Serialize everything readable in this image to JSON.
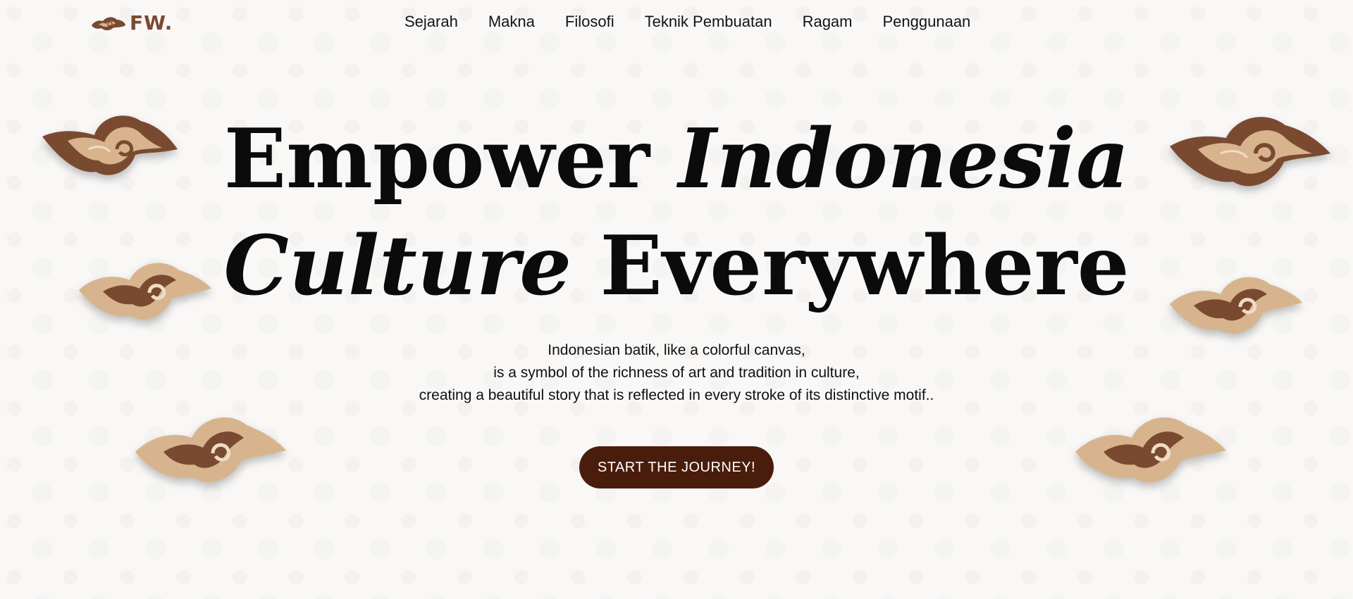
{
  "brand": {
    "logo_text": "FW.",
    "logo_icon": "megamendung-icon",
    "color": "#7a4a30"
  },
  "nav": {
    "items": [
      "Sejarah",
      "Makna",
      "Filosofi",
      "Teknik Pembuatan",
      "Ragam",
      "Penggunaan"
    ]
  },
  "hero": {
    "title_line1_a": "Empower",
    "title_line1_b": "Indonesia",
    "title_line2_a": "Culture",
    "title_line2_b": "Everywhere",
    "description": [
      "Indonesian batik, like a colorful canvas,",
      "is a symbol of the richness of art and tradition in culture,",
      "creating a beautiful story that is reflected in every stroke of its distinctive motif.."
    ],
    "cta_label": "START THE JOURNEY!"
  },
  "decorations": {
    "icon": "megamendung-cloud-icon",
    "colors": {
      "dark": "#7a4a30",
      "light": "#d8b48e",
      "cream": "#f0dcc6",
      "button": "#4a1c0c"
    }
  }
}
